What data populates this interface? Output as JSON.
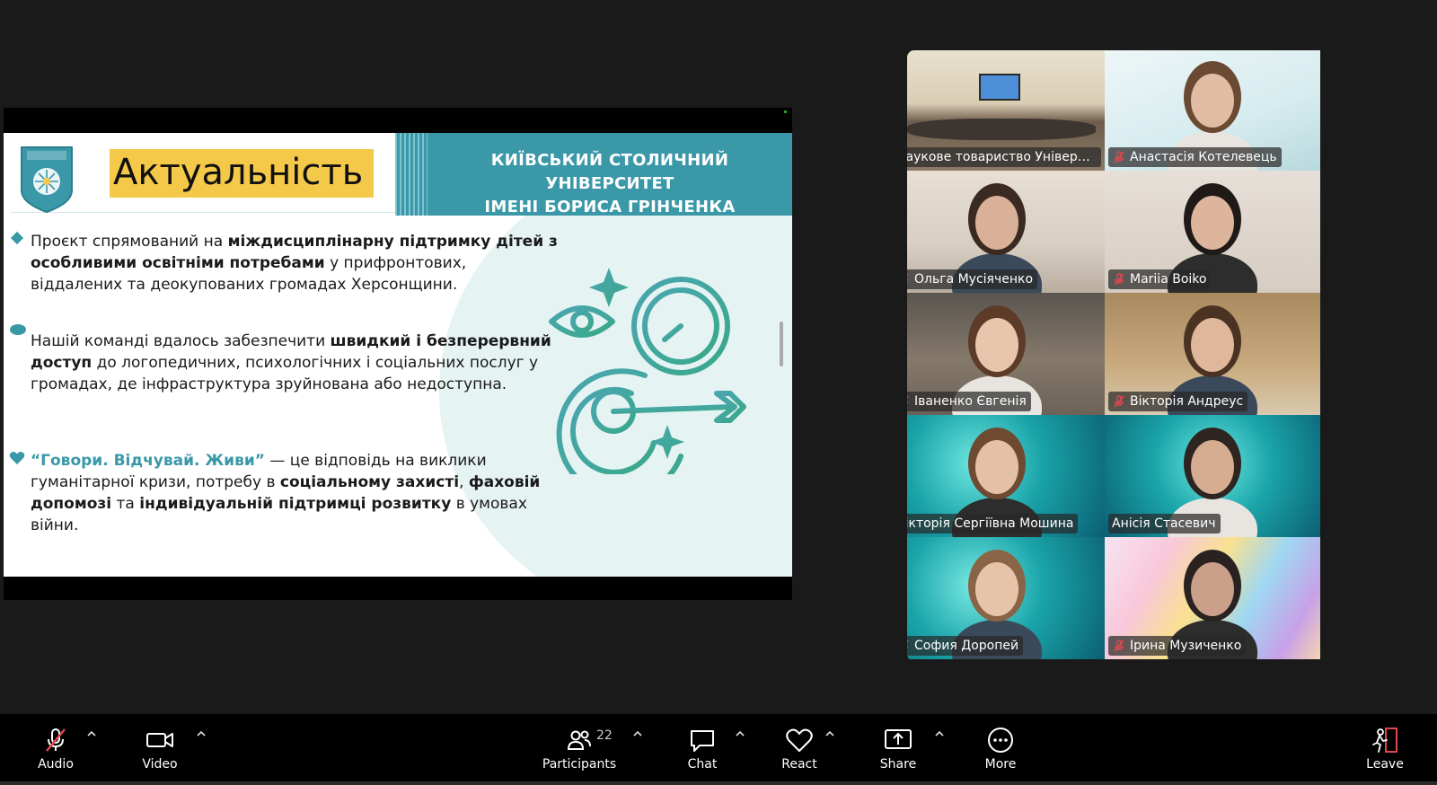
{
  "slide": {
    "title": "Актуальність",
    "university_line1": "КИЇВСЬКИЙ СТОЛИЧНИЙ УНІВЕРСИТЕТ",
    "university_line2": "ІМЕНІ БОРИСА ГРІНЧЕНКА",
    "bullet1": {
      "t1": "Проєкт спрямований на ",
      "b1": "міждисциплінарну підтримку дітей з особливими освітніми потребами",
      "t2": " у прифронтових, віддалених та деокупованих громадах Херсонщини."
    },
    "bullet2": {
      "t1": "Нашій команді вдалось забезпечити ",
      "b1": "швидкий і безперервний доступ",
      "t2": " до логопедичних, психологічних і соціальних послуг у громадах, де інфраструктура зруйнована або недоступна."
    },
    "bullet3": {
      "quote": "“Говори. Відчувай. Живи”",
      "t1": " — це відповідь на виклики гуманітарної кризи, потребу в ",
      "b1": "соціальному захисті",
      "t2": ", ",
      "b2": "фаховій допомозі",
      "t3": " та ",
      "b3": "індивідуальній підтримці розвитку",
      "t4": " в умовах війни."
    }
  },
  "participants": [
    {
      "name": "Наукове товариство Університ...",
      "muted": false,
      "active": false
    },
    {
      "name": "Анастасія Котелевець",
      "muted": true,
      "active": false
    },
    {
      "name": "Ольга Мусіяченко",
      "muted": true,
      "active": false
    },
    {
      "name": "Mariia Boiko",
      "muted": true,
      "active": false
    },
    {
      "name": "Іваненко Євгенія",
      "muted": true,
      "active": false
    },
    {
      "name": "Вікторія Андреус",
      "muted": true,
      "active": false
    },
    {
      "name": "Вікторія Сергіївна Мошина",
      "muted": false,
      "active": false
    },
    {
      "name": "Анісія Стасевич",
      "muted": false,
      "active": true
    },
    {
      "name": "София Доропей",
      "muted": true,
      "active": false
    },
    {
      "name": "Ірина Музиченко",
      "muted": true,
      "active": false
    }
  ],
  "toolbar": {
    "audio": "Audio",
    "video": "Video",
    "participants": "Participants",
    "participants_count": "22",
    "chat": "Chat",
    "react": "React",
    "share": "Share",
    "more": "More",
    "leave": "Leave"
  },
  "colors": {
    "accent_teal": "#3a98a8",
    "title_highlight": "#f4c94a",
    "active_speaker": "#2fe08f",
    "mute_red": "#e0484f"
  }
}
